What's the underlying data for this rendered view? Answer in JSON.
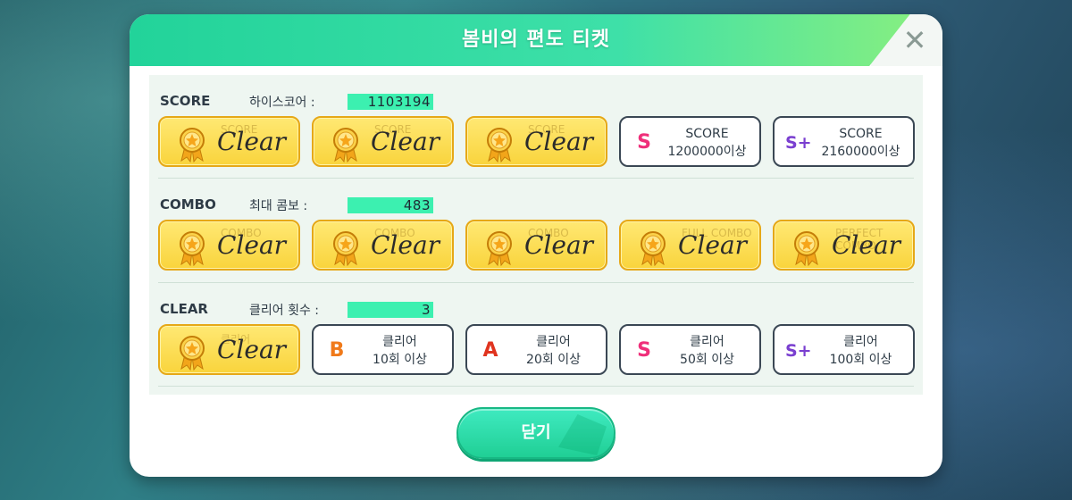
{
  "dialog": {
    "title": "봄비의 편도 티켓",
    "close_icon": "close-icon",
    "close_button_label": "닫기"
  },
  "colors": {
    "header_start": "#22d39a",
    "header_end": "#8cf07e",
    "value_highlight": "#3cf0b0",
    "cleared_card": "#f9d43c",
    "grade_s": "#ef2f7a",
    "grade_b": "#f07a1a",
    "grade_a": "#e0341f"
  },
  "sections": {
    "score": {
      "label": "SCORE",
      "stat_label": "하이스코어 :",
      "stat_value": "1103194",
      "cards": [
        {
          "status": "clear",
          "text": "Clear",
          "hint": "SCORE"
        },
        {
          "status": "clear",
          "text": "Clear",
          "hint": "SCORE"
        },
        {
          "status": "clear",
          "text": "Clear",
          "hint": "SCORE"
        },
        {
          "status": "locked",
          "grade": "S",
          "line1": "SCORE",
          "line2": "1200000이상"
        },
        {
          "status": "locked",
          "grade": "S+",
          "line1": "SCORE",
          "line2": "2160000이상"
        }
      ]
    },
    "combo": {
      "label": "COMBO",
      "stat_label": "최대 콤보 :",
      "stat_value": "483",
      "cards": [
        {
          "status": "clear",
          "text": "Clear",
          "hint": "COMBO"
        },
        {
          "status": "clear",
          "text": "Clear",
          "hint": "COMBO"
        },
        {
          "status": "clear",
          "text": "Clear",
          "hint": "COMBO"
        },
        {
          "status": "clear",
          "text": "Clear",
          "hint": "FULL COMBO"
        },
        {
          "status": "clear",
          "text": "Clear",
          "hint": "PERFECT COMBO"
        }
      ]
    },
    "clear": {
      "label": "CLEAR",
      "stat_label": "클리어 횟수 :",
      "stat_value": "3",
      "cards": [
        {
          "status": "clear",
          "text": "Clear",
          "hint": "클리어"
        },
        {
          "status": "locked",
          "grade": "B",
          "line1": "클리어",
          "line2": "10회 이상"
        },
        {
          "status": "locked",
          "grade": "A",
          "line1": "클리어",
          "line2": "20회 이상"
        },
        {
          "status": "locked",
          "grade": "S",
          "line1": "클리어",
          "line2": "50회 이상"
        },
        {
          "status": "locked",
          "grade": "S+",
          "line1": "클리어",
          "line2": "100회 이상"
        }
      ]
    }
  }
}
